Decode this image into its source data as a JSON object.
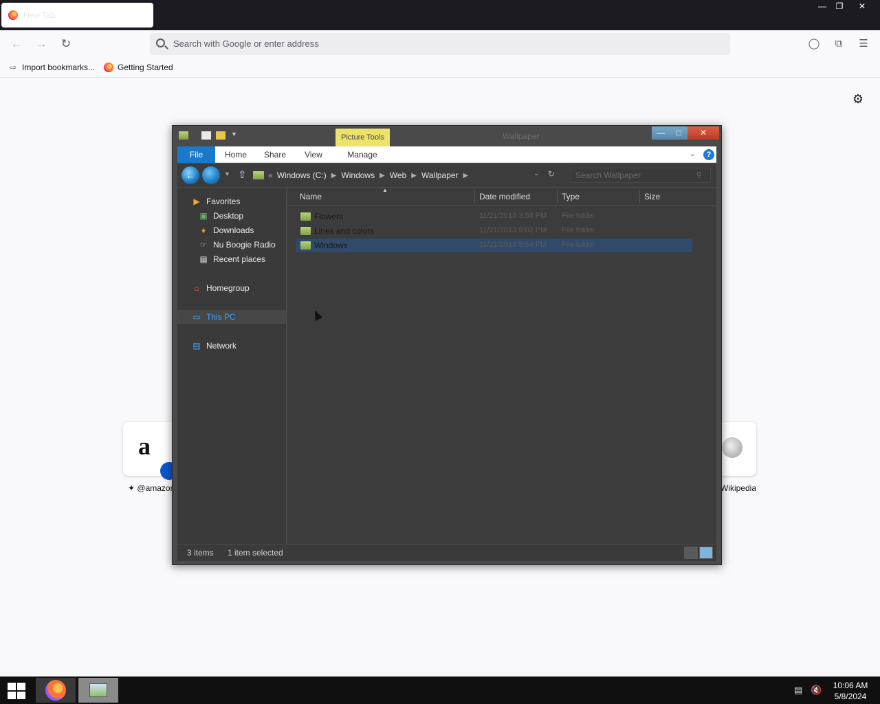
{
  "browser": {
    "tab_title": "New Tab",
    "url_placeholder": "Search with Google or enter address",
    "bookmarks": [
      "Import bookmarks...",
      "Getting Started"
    ],
    "shortcuts": [
      "@amazon",
      "Wikipedia"
    ],
    "colors": {
      "tabbar": "#1c1b22",
      "page": "#f9f9fb"
    }
  },
  "explorer": {
    "title": "Wallpaper",
    "picture_tools": "Picture Tools",
    "ribbon_tabs": [
      "File",
      "Home",
      "Share",
      "View",
      "Manage"
    ],
    "breadcrumb": [
      "Windows (C:)",
      "Windows",
      "Web",
      "Wallpaper"
    ],
    "breadcrumb_prefix": "«",
    "search_placeholder": "Search Wallpaper",
    "nav": {
      "favorites": "Favorites",
      "desktop": "Desktop",
      "downloads": "Downloads",
      "nu_boogie": "Nu Boogie Radio",
      "recent": "Recent places",
      "homegroup": "Homegroup",
      "this_pc": "This PC",
      "network": "Network"
    },
    "columns": [
      "Name",
      "Date modified",
      "Type",
      "Size"
    ],
    "rows": [
      {
        "name": "Flowers",
        "date": "11/21/2013 3:58 PM",
        "type": "File folder"
      },
      {
        "name": "Lines and colors",
        "date": "11/21/2013 9:02 PM",
        "type": "File folder"
      },
      {
        "name": "Windows",
        "date": "11/21/2013 5:54 PM",
        "type": "File folder"
      }
    ],
    "status": {
      "items": "3 items",
      "selected": "1 item selected"
    },
    "colors": {
      "file_tab": "#1979ca",
      "selection": "#2f4a6a",
      "this_pc": "#3aa3ff",
      "picture_tools": "#ece26c"
    }
  },
  "taskbar": {
    "time": "10:06 AM",
    "date": "5/8/2024"
  }
}
